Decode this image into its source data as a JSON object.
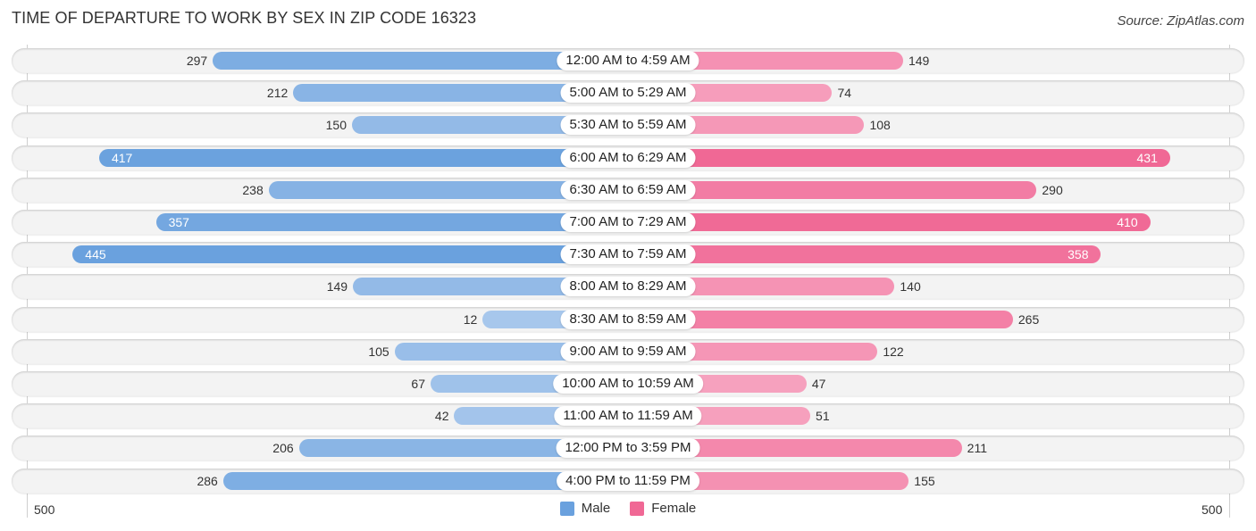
{
  "title": "TIME OF DEPARTURE TO WORK BY SEX IN ZIP CODE 16323",
  "source": "Source: ZipAtlas.com",
  "colors": {
    "male_dark": "#6aa1de",
    "male_light": "#a9c8ec",
    "female_dark": "#f06895",
    "female_light": "#f7a8c3"
  },
  "chart_data": {
    "type": "bar",
    "orientation": "horizontal-diverging",
    "title": "TIME OF DEPARTURE TO WORK BY SEX IN ZIP CODE 16323",
    "categories": [
      "12:00 AM to 4:59 AM",
      "5:00 AM to 5:29 AM",
      "5:30 AM to 5:59 AM",
      "6:00 AM to 6:29 AM",
      "6:30 AM to 6:59 AM",
      "7:00 AM to 7:29 AM",
      "7:30 AM to 7:59 AM",
      "8:00 AM to 8:29 AM",
      "8:30 AM to 8:59 AM",
      "9:00 AM to 9:59 AM",
      "10:00 AM to 10:59 AM",
      "11:00 AM to 11:59 AM",
      "12:00 PM to 3:59 PM",
      "4:00 PM to 11:59 PM"
    ],
    "series": [
      {
        "name": "Male",
        "values": [
          297,
          212,
          150,
          417,
          238,
          357,
          445,
          149,
          12,
          105,
          67,
          42,
          206,
          286
        ]
      },
      {
        "name": "Female",
        "values": [
          149,
          74,
          108,
          431,
          290,
          410,
          358,
          140,
          265,
          122,
          47,
          51,
          211,
          155
        ]
      }
    ],
    "xlim": [
      500,
      500
    ],
    "tick_labels": {
      "left": "500",
      "right": "500"
    },
    "legend": {
      "entries": [
        "Male",
        "Female"
      ],
      "placement": "bottom-center"
    },
    "grid": false
  }
}
